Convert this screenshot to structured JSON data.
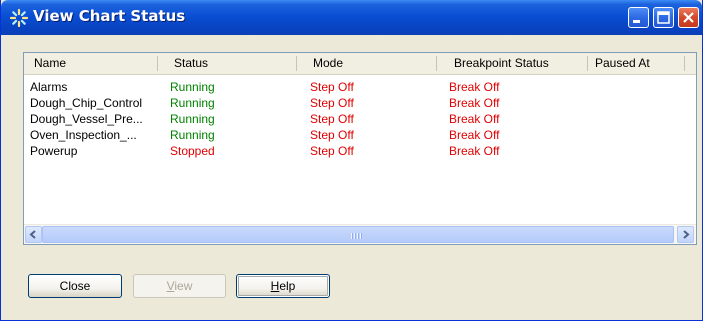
{
  "window": {
    "title": "View Chart Status"
  },
  "columns": [
    {
      "label": "Name"
    },
    {
      "label": "Status"
    },
    {
      "label": "Mode"
    },
    {
      "label": "Breakpoint Status"
    },
    {
      "label": "Paused At"
    }
  ],
  "rows": [
    {
      "name": "Alarms",
      "status": "Running",
      "mode": "Step Off",
      "breakpoint": "Break Off",
      "paused_at": ""
    },
    {
      "name": "Dough_Chip_Control",
      "status": "Running",
      "mode": "Step Off",
      "breakpoint": "Break Off",
      "paused_at": ""
    },
    {
      "name": "Dough_Vessel_Pre...",
      "status": "Running",
      "mode": "Step Off",
      "breakpoint": "Break Off",
      "paused_at": ""
    },
    {
      "name": "Oven_Inspection_...",
      "status": "Running",
      "mode": "Step Off",
      "breakpoint": "Break Off",
      "paused_at": ""
    },
    {
      "name": "Powerup",
      "status": "Stopped",
      "mode": "Step Off",
      "breakpoint": "Break Off",
      "paused_at": ""
    }
  ],
  "buttons": {
    "close": {
      "label": "Close"
    },
    "view": {
      "mnemonic": "V",
      "rest": "iew"
    },
    "help": {
      "mnemonic": "H",
      "rest": "elp"
    }
  },
  "colors": {
    "running": "#008000",
    "stopped": "#e00000",
    "step_off": "#e00000",
    "break_off": "#e00000"
  }
}
